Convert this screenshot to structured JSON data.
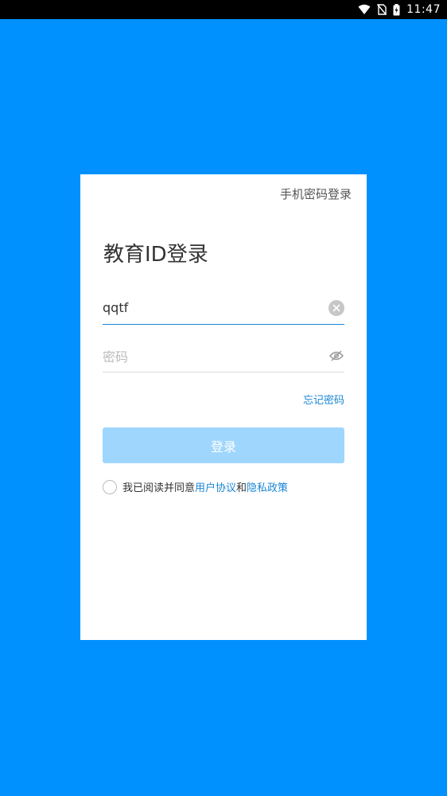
{
  "status_bar": {
    "time": "11:47"
  },
  "card": {
    "switch_label": "手机密码登录",
    "title": "教育ID登录",
    "account": {
      "value": "qqtf"
    },
    "password": {
      "placeholder": "密码"
    },
    "forgot_label": "忘记密码",
    "login_label": "登录",
    "agreement": {
      "prefix": "我已阅读并同意",
      "user_agreement": "用户协议",
      "and": "和",
      "privacy_policy": "隐私政策"
    }
  },
  "colors": {
    "background": "#0091ff",
    "accent": "#1a86d6",
    "login_button_disabled": "#9fd6fe"
  },
  "icons": {
    "wifi": "wifi-icon",
    "no_sim": "no-sim-icon",
    "battery": "battery-charging-icon",
    "clear": "clear-icon",
    "eye": "eye-off-icon"
  }
}
